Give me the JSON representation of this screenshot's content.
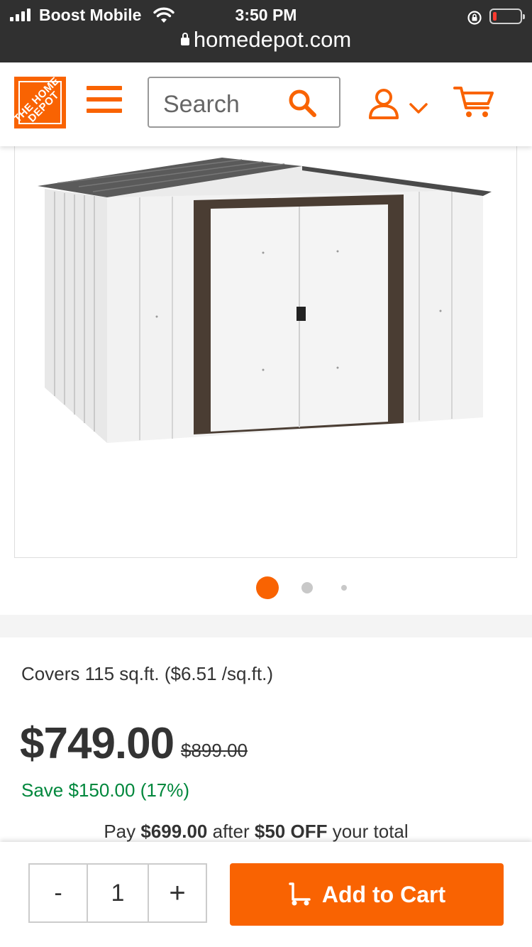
{
  "status_bar": {
    "carrier": "Boost Mobile",
    "time": "3:50 PM",
    "url": "homedepot.com"
  },
  "header": {
    "logo_text": "THE HOME DEPOT",
    "search": {
      "placeholder": "Search"
    }
  },
  "gallery": {
    "image_description_icon": "storage-shed-image",
    "pages": 3,
    "active_page": 1
  },
  "product": {
    "coverage": "Covers 115 sq.ft. ($6.51 /sq.ft.)",
    "price": "$749.00",
    "was_price": "$899.00",
    "savings": "Save $150.00 (17%)",
    "promo": {
      "prefix": "Pay",
      "amount": "$699.00",
      "middle": "after",
      "discount": "$50 OFF",
      "suffix": "your total"
    }
  },
  "cart_bar": {
    "minus_label": "-",
    "quantity": "1",
    "plus_label": "+",
    "add_to_cart_label": "Add to Cart"
  },
  "colors": {
    "brand_orange": "#f96302",
    "savings_green": "#00873c",
    "status_bar_bg": "#303030"
  }
}
